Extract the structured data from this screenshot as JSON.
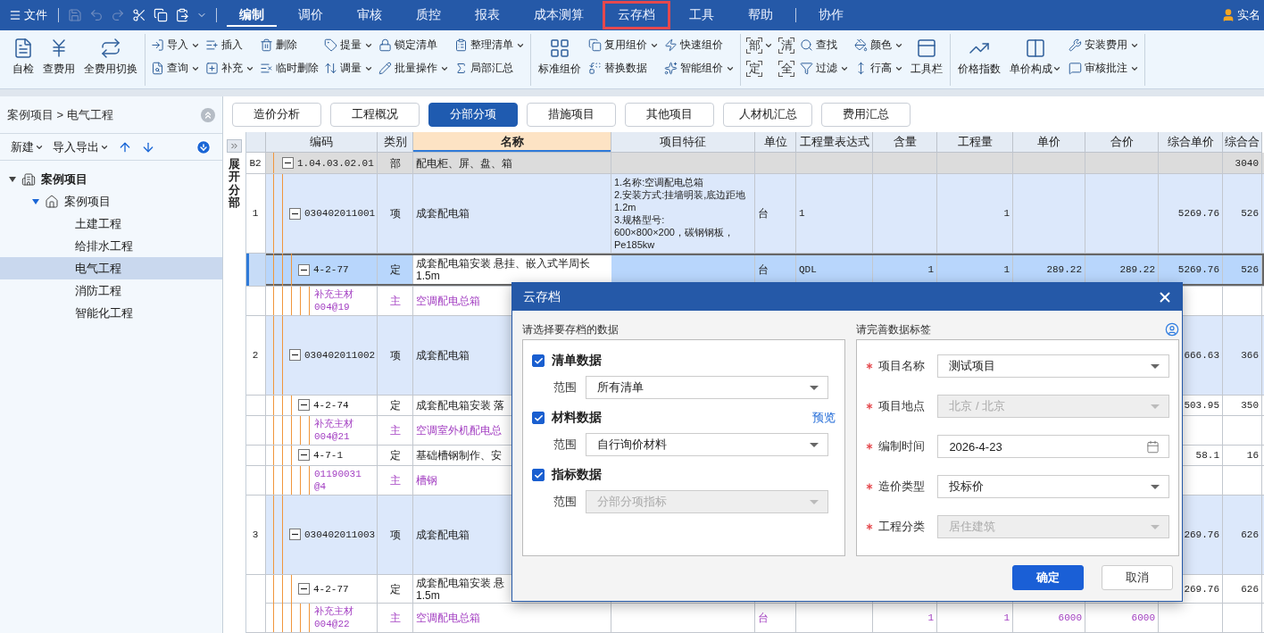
{
  "menu_bar": {
    "file_label": "文件",
    "quick_tools": [
      {
        "disabled": true
      },
      {
        "disabled": true
      },
      {
        "disabled": true
      },
      {
        "disabled": false
      },
      {
        "disabled": false
      },
      {
        "disabled": false
      },
      {
        "disabled": false
      }
    ],
    "items": [
      {
        "label": "编制",
        "selected": true,
        "highlighted": false
      },
      {
        "label": "调价",
        "selected": false,
        "highlighted": false
      },
      {
        "label": "审核",
        "selected": false,
        "highlighted": false
      },
      {
        "label": "质控",
        "selected": false,
        "highlighted": false
      },
      {
        "label": "报表",
        "selected": false,
        "highlighted": false
      },
      {
        "label": "成本测算",
        "selected": false,
        "highlighted": false
      },
      {
        "label": "云存档",
        "selected": false,
        "highlighted": true
      },
      {
        "label": "工具",
        "selected": false,
        "highlighted": false
      },
      {
        "label": "帮助",
        "selected": false,
        "highlighted": false
      },
      {
        "label": "协作",
        "selected": false,
        "highlighted": false
      }
    ],
    "user_label": "实名"
  },
  "ribbon": {
    "groups": [
      [
        {
          "kind": "large",
          "label": "自检",
          "dropdown": false
        },
        {
          "kind": "large",
          "label": "查费用",
          "dropdown": false
        },
        {
          "kind": "large",
          "label": "全费用切换",
          "dropdown": false
        }
      ],
      [
        {
          "kind": "small",
          "label": "导入",
          "dropdown": true
        },
        {
          "kind": "small",
          "label": "查询",
          "dropdown": true
        },
        {
          "kind": "small",
          "label": "插入",
          "dropdown": false
        },
        {
          "kind": "small",
          "label": "补充",
          "dropdown": true
        },
        {
          "kind": "small",
          "label": "删除",
          "dropdown": false
        },
        {
          "kind": "small",
          "label": "临时删除",
          "dropdown": false
        },
        {
          "kind": "small",
          "label": "提量",
          "dropdown": true
        },
        {
          "kind": "small",
          "label": "调量",
          "dropdown": true
        },
        {
          "kind": "small",
          "label": "锁定清单",
          "dropdown": false
        },
        {
          "kind": "small",
          "label": "批量操作",
          "dropdown": true
        },
        {
          "kind": "small",
          "label": "整理清单",
          "dropdown": true
        },
        {
          "kind": "small",
          "label": "局部汇总",
          "dropdown": false
        }
      ],
      [
        {
          "kind": "large",
          "label": "标准组价",
          "dropdown": false
        },
        {
          "kind": "small",
          "label": "复用组价",
          "dropdown": true
        },
        {
          "kind": "small",
          "label": "替换数据",
          "dropdown": false
        },
        {
          "kind": "small",
          "label": "快速组价",
          "dropdown": false
        },
        {
          "kind": "small",
          "label": "智能组价",
          "dropdown": true
        }
      ],
      [
        {
          "kind": "tag",
          "label": "部",
          "dropdown": true
        },
        {
          "kind": "tag",
          "label": "定",
          "dropdown": false
        },
        {
          "kind": "tag",
          "label": "清",
          "dropdown": false
        },
        {
          "kind": "tag",
          "label": "全",
          "dropdown": false
        },
        {
          "kind": "small",
          "label": "查找",
          "dropdown": false
        },
        {
          "kind": "small",
          "label": "过滤",
          "dropdown": true
        },
        {
          "kind": "small",
          "label": "颜色",
          "dropdown": true
        },
        {
          "kind": "small",
          "label": "行高",
          "dropdown": true
        },
        {
          "kind": "large",
          "label": "工具栏",
          "dropdown": false
        }
      ],
      [
        {
          "kind": "large",
          "label": "价格指数",
          "dropdown": false
        },
        {
          "kind": "large",
          "label": "单价构成",
          "dropdown": true
        },
        {
          "kind": "small",
          "label": "安装费用",
          "dropdown": true
        },
        {
          "kind": "small",
          "label": "审核批注",
          "dropdown": true
        }
      ]
    ]
  },
  "sidebar": {
    "breadcrumb": "案例项目 > 电气工程",
    "toolbar": [
      {
        "label": "新建",
        "dropdown": true
      },
      {
        "label": "导入导出",
        "dropdown": true
      }
    ],
    "tree": [
      {
        "label": "案例项目",
        "expanded": true,
        "selected": false,
        "children": [
          {
            "label": "案例项目",
            "expanded": true,
            "selected": false,
            "children": [
              {
                "label": "土建工程",
                "selected": false
              },
              {
                "label": "给排水工程",
                "selected": false
              },
              {
                "label": "电气工程",
                "selected": true
              },
              {
                "label": "消防工程",
                "selected": false
              },
              {
                "label": "智能化工程",
                "selected": false
              }
            ]
          }
        ]
      }
    ]
  },
  "tabs": [
    {
      "label": "造价分析",
      "selected": false
    },
    {
      "label": "工程概况",
      "selected": false
    },
    {
      "label": "分部分项",
      "selected": true
    },
    {
      "label": "措施项目",
      "selected": false
    },
    {
      "label": "其他项目",
      "selected": false
    },
    {
      "label": "人材机汇总",
      "selected": false
    },
    {
      "label": "费用汇总",
      "selected": false
    }
  ],
  "side_strip_label": "展开分部",
  "table": {
    "columns": [
      {
        "selected": false
      },
      {
        "label": "编码",
        "selected": false
      },
      {
        "label": "类别",
        "selected": false
      },
      {
        "label": "名称",
        "selected": true
      },
      {
        "label": "项目特征",
        "selected": false
      },
      {
        "label": "单位",
        "selected": false
      },
      {
        "label": "工程量表达式",
        "selected": false
      },
      {
        "label": "含量",
        "selected": false
      },
      {
        "label": "工程量",
        "selected": false
      },
      {
        "label": "单价",
        "selected": false
      },
      {
        "label": "合价",
        "selected": false
      },
      {
        "label": "综合单价",
        "selected": false
      },
      {
        "label": "综合合",
        "selected": false
      }
    ],
    "rows": [
      {
        "kind": "division",
        "selected": false,
        "num": "B2",
        "code": "1.04.03.02.01",
        "type": "部",
        "name": "配电柜、屏、盘、箱",
        "combined_total": "3040"
      },
      {
        "kind": "item",
        "selected": false,
        "num": "1",
        "code": "030402011001",
        "type": "项",
        "name": "成套配电箱",
        "feature": "1.名称:空调配电总箱\n2.安装方式:挂墙明装,底边距地1.2m\n3.规格型号:\n600×800×200，碳钢钢板，Pe185kw",
        "unit": "台",
        "expr": "1",
        "qty": "1",
        "unit_total": "5269.76",
        "combined_total": "526"
      },
      {
        "kind": "quota",
        "selected": true,
        "code": "4-2-77",
        "type": "定",
        "name": "成套配电箱安装 悬挂、嵌入式半周长1.5m",
        "unit": "台",
        "expr": "QDL",
        "content": "1",
        "qty": "1",
        "price": "289.22",
        "total": "289.22",
        "unit_total": "5269.76",
        "combined_total": "526"
      },
      {
        "kind": "material",
        "selected": false,
        "code": "补充主材\n004@19",
        "type": "主",
        "name": "空调配电总箱"
      },
      {
        "kind": "item",
        "selected": false,
        "num": "2",
        "code": "030402011002",
        "type": "项",
        "name": "成套配电箱",
        "unit_total": "666.63",
        "combined_total": "366"
      },
      {
        "kind": "quota",
        "selected": false,
        "code": "4-2-74",
        "type": "定",
        "name": "成套配电箱安装 落",
        "unit_total": "503.95",
        "combined_total": "350"
      },
      {
        "kind": "material",
        "selected": false,
        "code": "补充主材\n004@21",
        "type": "主",
        "name": "空调室外机配电总"
      },
      {
        "kind": "quota",
        "selected": false,
        "code": "4-7-1",
        "type": "定",
        "name": "基础槽钢制作、安",
        "unit_total": "58.1",
        "combined_total": "16"
      },
      {
        "kind": "material",
        "selected": false,
        "code": "01190031\n@4",
        "type": "主",
        "name": "槽钢"
      },
      {
        "kind": "item",
        "selected": false,
        "num": "3",
        "code": "030402011003",
        "type": "项",
        "name": "成套配电箱",
        "unit_total": "269.76",
        "combined_total": "626"
      },
      {
        "kind": "quota",
        "selected": false,
        "code": "4-2-77",
        "type": "定",
        "name": "成套配电箱安装 悬\n1.5m",
        "unit_total": "269.76",
        "combined_total": "626"
      },
      {
        "kind": "material",
        "selected": false,
        "code": "补充主材\n004@22",
        "type": "主",
        "name": "空调配电总箱",
        "unit": "台",
        "content": "1",
        "qty": "1",
        "price": "6000",
        "total": "6000"
      }
    ]
  },
  "dialog": {
    "title": "云存档",
    "left_label": "请选择要存档的数据",
    "right_label": "请完善数据标签",
    "data_groups": [
      {
        "label": "清单数据",
        "checked": true,
        "range_label": "范围",
        "value": "所有清单",
        "disabled": false
      },
      {
        "label": "材料数据",
        "checked": true,
        "range_label": "范围",
        "value": "自行询价材料",
        "disabled": false,
        "link": "预览"
      },
      {
        "label": "指标数据",
        "checked": true,
        "range_label": "范围",
        "value": "分部分项指标",
        "disabled": true
      }
    ],
    "fields": [
      {
        "label": "项目名称",
        "required": true,
        "kind": "select",
        "value": "测试项目",
        "disabled": false
      },
      {
        "label": "项目地点",
        "required": true,
        "kind": "select",
        "value": "北京 / 北京",
        "disabled": true
      },
      {
        "label": "编制时间",
        "required": true,
        "kind": "date",
        "value": "2026-4-23",
        "disabled": false
      },
      {
        "label": "造价类型",
        "required": true,
        "kind": "select",
        "value": "投标价",
        "disabled": false
      },
      {
        "label": "工程分类",
        "required": true,
        "kind": "select",
        "value": "居住建筑",
        "disabled": true
      }
    ],
    "buttons": [
      {
        "label": "确定",
        "primary": true
      },
      {
        "label": "取消",
        "primary": false
      }
    ]
  }
}
